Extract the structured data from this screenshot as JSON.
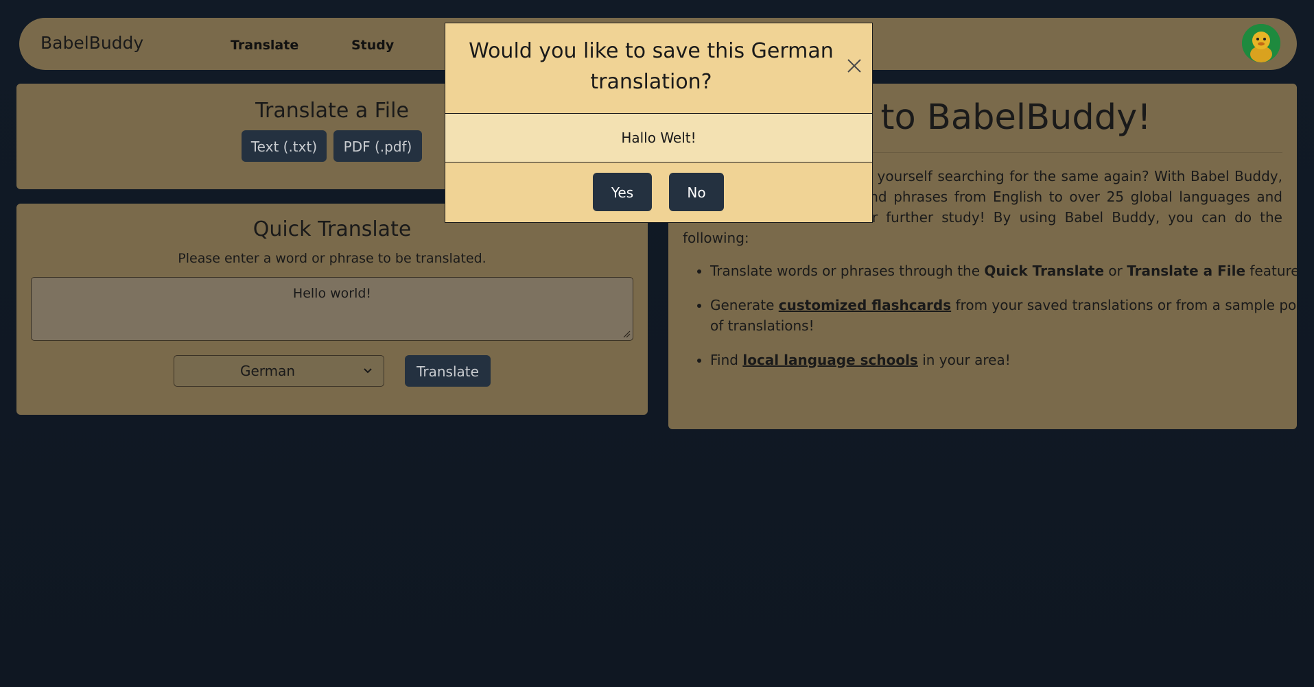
{
  "navbar": {
    "brand": "BabelBuddy",
    "links": [
      "Translate",
      "Study"
    ],
    "avatar_icon": "duck-avatar-icon"
  },
  "file_panel": {
    "title": "Translate a File",
    "buttons": [
      "Text (.txt)",
      "PDF (.pdf)"
    ]
  },
  "quick_panel": {
    "title": "Quick Translate",
    "subtitle": "Please enter a word or phrase to be translated.",
    "input_value": "Hello world!",
    "language_selected": "German",
    "translate_button": "Translate"
  },
  "welcome": {
    "title_visible": "me to BabelBuddy!",
    "intro_visible": "translating app only to find yourself searching for the same again? With Babel Buddy, you can translate words and phrases from English to over 25 global languages and save those translations for further study! By using Babel Buddy, you can do the following:",
    "features": {
      "f1_pre": "Translate words or phrases through the ",
      "f1_b1": "Quick Translate",
      "f1_mid": " or ",
      "f1_b2": "Translate a File",
      "f1_post": " features!",
      "f2_pre": "Generate ",
      "f2_link": "customized flashcards",
      "f2_post": " from your saved translations or from a sample pool of translations!",
      "f3_pre": "Find ",
      "f3_link": "local language schools",
      "f3_post": " in your area!"
    }
  },
  "modal": {
    "title": "Would you like to save this German translation?",
    "translation": "Hallo Welt!",
    "yes": "Yes",
    "no": "No",
    "close_icon": "close-icon"
  },
  "colors": {
    "background": "#111a26",
    "panel": "#7a6a4b",
    "modal": "#f0d395",
    "button_dark": "#243140"
  }
}
